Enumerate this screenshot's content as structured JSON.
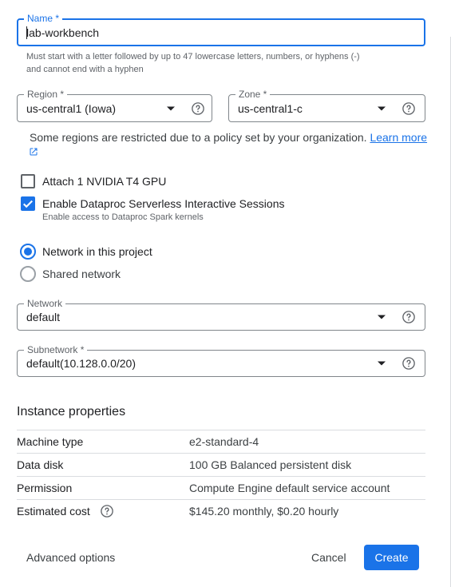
{
  "name_field": {
    "label": "Name *",
    "value": "lab-workbench",
    "value_prefix": "l",
    "value_rest": "ab-workbench",
    "hint_line1": "Must start with a letter followed by up to 47 lowercase letters, numbers, or hyphens (-)",
    "hint_line2": "and cannot end with a hyphen"
  },
  "region_field": {
    "label": "Region *",
    "value": "us-central1 (Iowa)"
  },
  "zone_field": {
    "label": "Zone *",
    "value": "us-central1-c"
  },
  "regions_notice": {
    "text": "Some regions are restricted due to a policy set by your organization.",
    "link": "Learn more"
  },
  "gpu_option": {
    "label": "Attach 1 NVIDIA T4 GPU",
    "checked": false
  },
  "dataproc_option": {
    "label": "Enable Dataproc Serverless Interactive Sessions",
    "sub": "Enable access to Dataproc Spark kernels",
    "checked": true
  },
  "network_choice": [
    {
      "label": "Network in this project",
      "selected": true
    },
    {
      "label": "Shared network",
      "selected": false
    }
  ],
  "network_field": {
    "label": "Network",
    "value": "default"
  },
  "subnetwork_field": {
    "label": "Subnetwork *",
    "value": "default(10.128.0.0/20)"
  },
  "instance_properties": {
    "title": "Instance properties",
    "rows": [
      {
        "key": "Machine type",
        "value": "e2-standard-4"
      },
      {
        "key": "Data disk",
        "value": "100 GB Balanced persistent disk"
      },
      {
        "key": "Permission",
        "value": "Compute Engine default service account"
      },
      {
        "key": "Estimated cost",
        "value": "$145.20 monthly, $0.20 hourly"
      }
    ]
  },
  "footer": {
    "advanced": "Advanced options",
    "cancel": "Cancel",
    "create": "Create"
  },
  "colors": {
    "accent": "#1a73e8",
    "text": "#202124",
    "muted": "#5f6368",
    "border": "#80868b"
  },
  "icons": {
    "help": "help-circle-icon",
    "external": "open-in-new-icon",
    "dropdown": "arrow-drop-down-icon",
    "check": "check-icon"
  }
}
